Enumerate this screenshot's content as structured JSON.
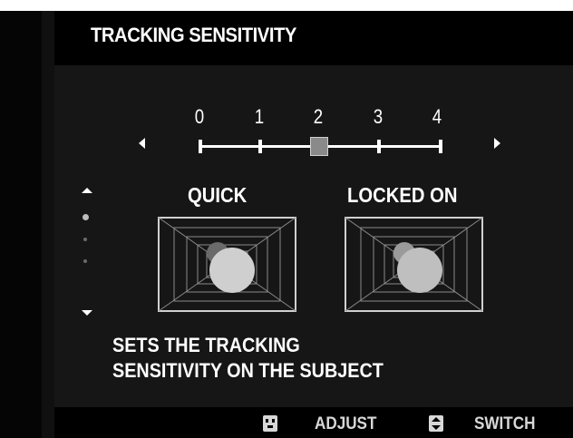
{
  "screen": {
    "title": "TRACKING SENSITIVITY",
    "description_line1": "SETS THE TRACKING",
    "description_line2": "SENSITIVITY ON THE SUBJECT"
  },
  "slider": {
    "ticks": [
      "0",
      "1",
      "2",
      "3",
      "4"
    ],
    "selected_value": 2,
    "left_icon": "triangle-left-icon",
    "right_icon": "triangle-right-icon"
  },
  "options": {
    "quick_label": "QUICK",
    "locked_on_label": "LOCKED ON"
  },
  "footer": {
    "adjust_label": "ADJUST",
    "adjust_icon": "dpad-icon",
    "switch_label": "SWITCH",
    "switch_icon": "up-down-arrows-icon"
  },
  "colors": {
    "background": "#161616",
    "bar": "#000000",
    "text": "#ffffff",
    "marker": "#8a8a8a"
  }
}
